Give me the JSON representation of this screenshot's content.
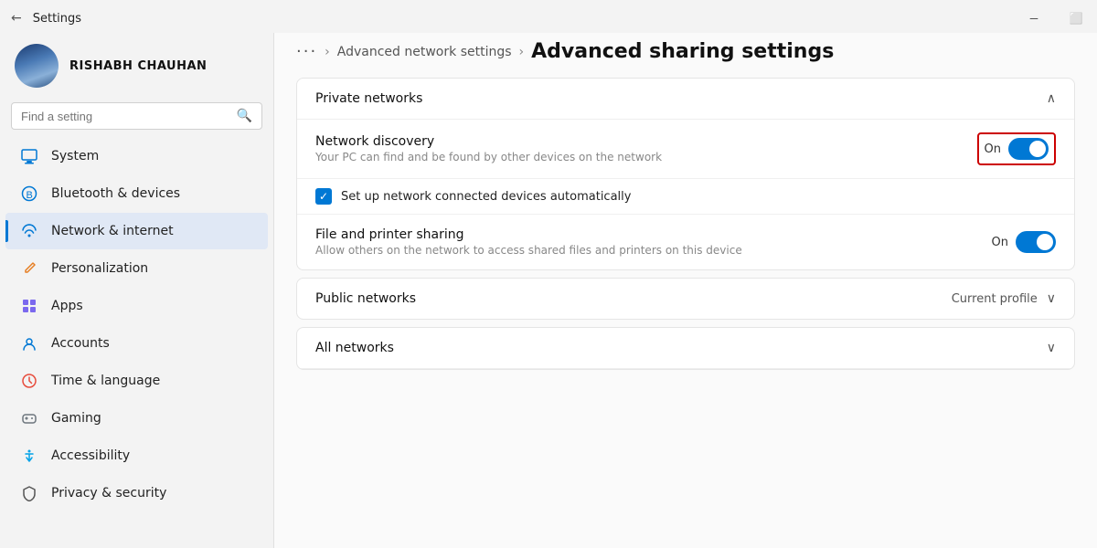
{
  "window": {
    "title": "Settings",
    "minimize_label": "─",
    "restore_label": "⬜"
  },
  "user": {
    "name": "RISHABH CHAUHAN"
  },
  "search": {
    "placeholder": "Find a setting"
  },
  "sidebar": {
    "items": [
      {
        "id": "system",
        "label": "System",
        "icon": "🖥",
        "icon_color": "#0078d4",
        "active": false
      },
      {
        "id": "bluetooth",
        "label": "Bluetooth & devices",
        "icon": "⬡",
        "icon_color": "#0078d4",
        "active": false
      },
      {
        "id": "network",
        "label": "Network & internet",
        "icon": "🌐",
        "icon_color": "#0078d4",
        "active": true
      },
      {
        "id": "personalization",
        "label": "Personalization",
        "icon": "✏",
        "icon_color": "#e67e22",
        "active": false
      },
      {
        "id": "apps",
        "label": "Apps",
        "icon": "⊞",
        "icon_color": "#7b68ee",
        "active": false
      },
      {
        "id": "accounts",
        "label": "Accounts",
        "icon": "👤",
        "icon_color": "#0078d4",
        "active": false
      },
      {
        "id": "time",
        "label": "Time & language",
        "icon": "🌍",
        "icon_color": "#e74c3c",
        "active": false
      },
      {
        "id": "gaming",
        "label": "Gaming",
        "icon": "🎮",
        "icon_color": "#6c757d",
        "active": false
      },
      {
        "id": "accessibility",
        "label": "Accessibility",
        "icon": "♿",
        "icon_color": "#00a2e8",
        "active": false
      },
      {
        "id": "privacy",
        "label": "Privacy & security",
        "icon": "🛡",
        "icon_color": "#555",
        "active": false
      }
    ]
  },
  "breadcrumb": {
    "dots": "···",
    "parent": "Advanced network settings",
    "current": "Advanced sharing settings"
  },
  "sections": {
    "private": {
      "title": "Private networks",
      "chevron": "∧",
      "network_discovery": {
        "label": "Network discovery",
        "desc": "Your PC can find and be found by other devices on the network",
        "state": "On",
        "enabled": true,
        "highlighted": true
      },
      "auto_connect": {
        "label": "Set up network connected devices automatically",
        "checked": true
      },
      "file_sharing": {
        "label": "File and printer sharing",
        "desc": "Allow others on the network to access shared files and printers on this device",
        "state": "On",
        "enabled": true
      }
    },
    "public": {
      "title": "Public networks",
      "profile_label": "Current profile",
      "chevron": "∨"
    },
    "all": {
      "title": "All networks",
      "chevron": "∨"
    }
  }
}
